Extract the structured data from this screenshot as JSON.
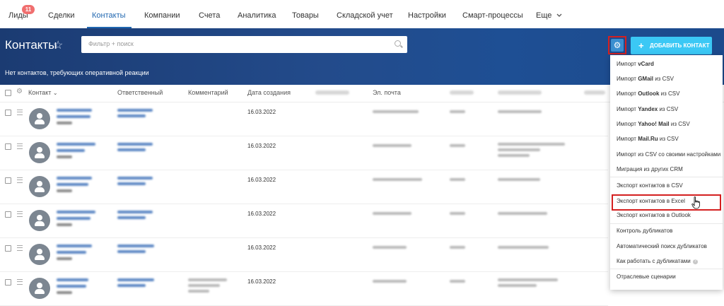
{
  "nav": {
    "items": [
      {
        "label": "Лиды",
        "badge": "11"
      },
      {
        "label": "Сделки"
      },
      {
        "label": "Контакты",
        "active": true
      },
      {
        "label": "Компании"
      },
      {
        "label": "Счета"
      },
      {
        "label": "Аналитика"
      },
      {
        "label": "Товары"
      },
      {
        "label": "Складской учет"
      },
      {
        "label": "Настройки"
      },
      {
        "label": "Смарт-процессы"
      },
      {
        "label": "Еще"
      }
    ]
  },
  "header": {
    "title": "Контакты",
    "filter_placeholder": "Фильтр + поиск",
    "add_button": "ДОБАВИТЬ КОНТАКТ",
    "no_contacts_text": "Нет контактов, требующих оперативной реакции"
  },
  "table": {
    "columns": {
      "contact": "Контакт",
      "responsible": "Ответственный",
      "comment": "Комментарий",
      "created": "Дата создания",
      "email": "Эл. почта"
    },
    "rows": [
      {
        "created": "16.03.2022"
      },
      {
        "created": "16.03.2022"
      },
      {
        "created": "16.03.2022"
      },
      {
        "created": "16.03.2022"
      },
      {
        "created": "16.03.2022"
      },
      {
        "created": "16.03.2022"
      }
    ]
  },
  "menu": {
    "items": [
      {
        "pre": "Импорт ",
        "bold": "vCard",
        "post": ""
      },
      {
        "pre": "Импорт ",
        "bold": "GMail",
        "post": " из CSV"
      },
      {
        "pre": "Импорт ",
        "bold": "Outlook",
        "post": " из CSV"
      },
      {
        "pre": "Импорт ",
        "bold": "Yandex",
        "post": " из CSV"
      },
      {
        "pre": "Импорт ",
        "bold": "Yahoo! Mail",
        "post": " из CSV"
      },
      {
        "pre": "Импорт ",
        "bold": "Mail.Ru",
        "post": " из CSV"
      },
      {
        "pre": "Импорт из CSV со своими настройками",
        "bold": "",
        "post": ""
      },
      {
        "pre": "Миграция из других CRM",
        "bold": "",
        "post": ""
      },
      {
        "pre": "Экспорт контактов в CSV",
        "bold": "",
        "post": ""
      },
      {
        "pre": "Экспорт контактов в Excel",
        "bold": "",
        "post": "",
        "highlighted": true
      },
      {
        "pre": "Экспорт контактов в Outlook",
        "bold": "",
        "post": ""
      },
      {
        "pre": "Контроль дубликатов",
        "bold": "",
        "post": ""
      },
      {
        "pre": "Автоматический поиск дубликатов",
        "bold": "",
        "post": ""
      },
      {
        "pre": "Как работать с дубликатами",
        "bold": "",
        "post": ""
      },
      {
        "pre": "Отраслевые сценарии",
        "bold": "",
        "post": ""
      }
    ]
  },
  "icons": {
    "star": "star-icon",
    "search": "search-icon",
    "settings": "gear-icon",
    "add": "plus-icon",
    "avatar": "user-avatar-icon",
    "drag": "menu-lines-icon",
    "help": "question-icon",
    "cursor": "hand-pointer-icon"
  },
  "colors": {
    "header_bg": "#1f4583",
    "add_button": "#3bc8f5",
    "gear_button": "#3b8fd0",
    "highlight": "#d42020",
    "nav_active": "#2067b0"
  }
}
